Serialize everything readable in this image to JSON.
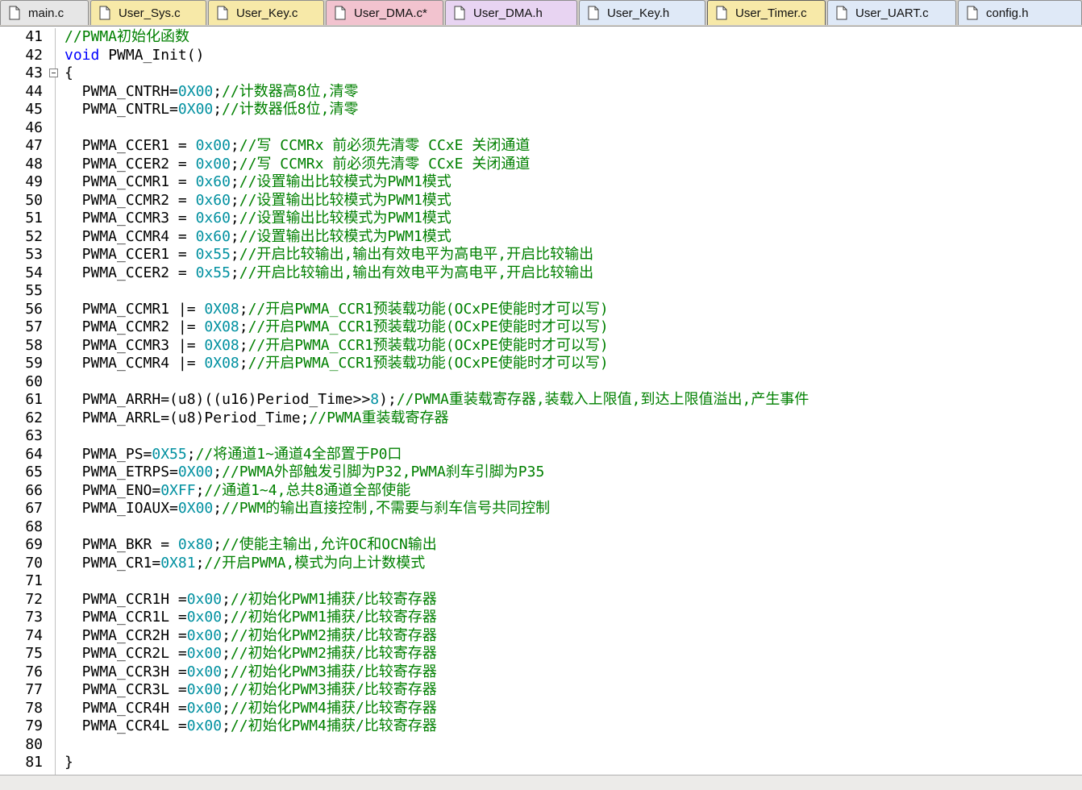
{
  "tabs": [
    {
      "label": "main.c",
      "bg": "#e6e6e6",
      "active": false
    },
    {
      "label": "User_Sys.c",
      "bg": "#f7e9a8",
      "active": false
    },
    {
      "label": "User_Key.c",
      "bg": "#f7e9a8",
      "active": false
    },
    {
      "label": "User_DMA.c*",
      "bg": "#f2c3cf",
      "active": false
    },
    {
      "label": "User_DMA.h",
      "bg": "#e8d4f2",
      "active": false
    },
    {
      "label": "User_Key.h",
      "bg": "#dfe9f7",
      "active": false
    },
    {
      "label": "User_Timer.c",
      "bg": "#f7e9a8",
      "active": true
    },
    {
      "label": "User_UART.c",
      "bg": "#dfe9f7",
      "active": false
    },
    {
      "label": "config.h",
      "bg": "#dfe9f7",
      "active": false
    }
  ],
  "colors": {
    "keyword": "#0000ff",
    "number": "#0090a0",
    "comment": "#008000",
    "text": "#000000"
  },
  "code_lines": [
    {
      "n": "41",
      "tokens": [
        {
          "t": "c",
          "v": "//PWMA初始化函数"
        }
      ]
    },
    {
      "n": "42",
      "tokens": [
        {
          "t": "k",
          "v": "void"
        },
        {
          "t": "x",
          "v": " PWMA_Init()"
        }
      ]
    },
    {
      "n": "43",
      "fold": true,
      "tokens": [
        {
          "t": "x",
          "v": "{"
        }
      ]
    },
    {
      "n": "44",
      "tokens": [
        {
          "t": "x",
          "v": "  PWMA_CNTRH="
        },
        {
          "t": "n",
          "v": "0X00"
        },
        {
          "t": "x",
          "v": ";"
        },
        {
          "t": "c",
          "v": "//计数器高8位,清零"
        }
      ]
    },
    {
      "n": "45",
      "tokens": [
        {
          "t": "x",
          "v": "  PWMA_CNTRL="
        },
        {
          "t": "n",
          "v": "0X00"
        },
        {
          "t": "x",
          "v": ";"
        },
        {
          "t": "c",
          "v": "//计数器低8位,清零"
        }
      ]
    },
    {
      "n": "46",
      "tokens": []
    },
    {
      "n": "47",
      "tokens": [
        {
          "t": "x",
          "v": "  PWMA_CCER1 = "
        },
        {
          "t": "n",
          "v": "0x00"
        },
        {
          "t": "x",
          "v": ";"
        },
        {
          "t": "c",
          "v": "//写 CCMRx 前必须先清零 CCxE 关闭通道"
        }
      ]
    },
    {
      "n": "48",
      "tokens": [
        {
          "t": "x",
          "v": "  PWMA_CCER2 = "
        },
        {
          "t": "n",
          "v": "0x00"
        },
        {
          "t": "x",
          "v": ";"
        },
        {
          "t": "c",
          "v": "//写 CCMRx 前必须先清零 CCxE 关闭通道"
        }
      ]
    },
    {
      "n": "49",
      "tokens": [
        {
          "t": "x",
          "v": "  PWMA_CCMR1 = "
        },
        {
          "t": "n",
          "v": "0x60"
        },
        {
          "t": "x",
          "v": ";"
        },
        {
          "t": "c",
          "v": "//设置输出比较模式为PWM1模式"
        }
      ]
    },
    {
      "n": "50",
      "tokens": [
        {
          "t": "x",
          "v": "  PWMA_CCMR2 = "
        },
        {
          "t": "n",
          "v": "0x60"
        },
        {
          "t": "x",
          "v": ";"
        },
        {
          "t": "c",
          "v": "//设置输出比较模式为PWM1模式"
        }
      ]
    },
    {
      "n": "51",
      "tokens": [
        {
          "t": "x",
          "v": "  PWMA_CCMR3 = "
        },
        {
          "t": "n",
          "v": "0x60"
        },
        {
          "t": "x",
          "v": ";"
        },
        {
          "t": "c",
          "v": "//设置输出比较模式为PWM1模式"
        }
      ]
    },
    {
      "n": "52",
      "tokens": [
        {
          "t": "x",
          "v": "  PWMA_CCMR4 = "
        },
        {
          "t": "n",
          "v": "0x60"
        },
        {
          "t": "x",
          "v": ";"
        },
        {
          "t": "c",
          "v": "//设置输出比较模式为PWM1模式"
        }
      ]
    },
    {
      "n": "53",
      "tokens": [
        {
          "t": "x",
          "v": "  PWMA_CCER1 = "
        },
        {
          "t": "n",
          "v": "0x55"
        },
        {
          "t": "x",
          "v": ";"
        },
        {
          "t": "c",
          "v": "//开启比较输出,输出有效电平为高电平,开启比较输出"
        }
      ]
    },
    {
      "n": "54",
      "tokens": [
        {
          "t": "x",
          "v": "  PWMA_CCER2 = "
        },
        {
          "t": "n",
          "v": "0x55"
        },
        {
          "t": "x",
          "v": ";"
        },
        {
          "t": "c",
          "v": "//开启比较输出,输出有效电平为高电平,开启比较输出"
        }
      ]
    },
    {
      "n": "55",
      "tokens": []
    },
    {
      "n": "56",
      "tokens": [
        {
          "t": "x",
          "v": "  PWMA_CCMR1 |= "
        },
        {
          "t": "n",
          "v": "0X08"
        },
        {
          "t": "x",
          "v": ";"
        },
        {
          "t": "c",
          "v": "//开启PWMA_CCR1预装载功能(OCxPE使能时才可以写)"
        }
      ]
    },
    {
      "n": "57",
      "tokens": [
        {
          "t": "x",
          "v": "  PWMA_CCMR2 |= "
        },
        {
          "t": "n",
          "v": "0X08"
        },
        {
          "t": "x",
          "v": ";"
        },
        {
          "t": "c",
          "v": "//开启PWMA_CCR1预装载功能(OCxPE使能时才可以写)"
        }
      ]
    },
    {
      "n": "58",
      "tokens": [
        {
          "t": "x",
          "v": "  PWMA_CCMR3 |= "
        },
        {
          "t": "n",
          "v": "0X08"
        },
        {
          "t": "x",
          "v": ";"
        },
        {
          "t": "c",
          "v": "//开启PWMA_CCR1预装载功能(OCxPE使能时才可以写)"
        }
      ]
    },
    {
      "n": "59",
      "tokens": [
        {
          "t": "x",
          "v": "  PWMA_CCMR4 |= "
        },
        {
          "t": "n",
          "v": "0X08"
        },
        {
          "t": "x",
          "v": ";"
        },
        {
          "t": "c",
          "v": "//开启PWMA_CCR1预装载功能(OCxPE使能时才可以写)"
        }
      ]
    },
    {
      "n": "60",
      "tokens": []
    },
    {
      "n": "61",
      "tokens": [
        {
          "t": "x",
          "v": "  PWMA_ARRH=(u8)((u16)Period_Time>>"
        },
        {
          "t": "n",
          "v": "8"
        },
        {
          "t": "x",
          "v": ");"
        },
        {
          "t": "c",
          "v": "//PWMA重装载寄存器,装载入上限值,到达上限值溢出,产生事件"
        }
      ]
    },
    {
      "n": "62",
      "tokens": [
        {
          "t": "x",
          "v": "  PWMA_ARRL=(u8)Period_Time;"
        },
        {
          "t": "c",
          "v": "//PWMA重装载寄存器"
        }
      ]
    },
    {
      "n": "63",
      "tokens": []
    },
    {
      "n": "64",
      "tokens": [
        {
          "t": "x",
          "v": "  PWMA_PS="
        },
        {
          "t": "n",
          "v": "0X55"
        },
        {
          "t": "x",
          "v": ";"
        },
        {
          "t": "c",
          "v": "//将通道1~通道4全部置于P0口"
        }
      ]
    },
    {
      "n": "65",
      "tokens": [
        {
          "t": "x",
          "v": "  PWMA_ETRPS="
        },
        {
          "t": "n",
          "v": "0X00"
        },
        {
          "t": "x",
          "v": ";"
        },
        {
          "t": "c",
          "v": "//PWMA外部触发引脚为P32,PWMA刹车引脚为P35"
        }
      ]
    },
    {
      "n": "66",
      "tokens": [
        {
          "t": "x",
          "v": "  PWMA_ENO="
        },
        {
          "t": "n",
          "v": "0XFF"
        },
        {
          "t": "x",
          "v": ";"
        },
        {
          "t": "c",
          "v": "//通道1~4,总共8通道全部使能"
        }
      ]
    },
    {
      "n": "67",
      "tokens": [
        {
          "t": "x",
          "v": "  PWMA_IOAUX="
        },
        {
          "t": "n",
          "v": "0X00"
        },
        {
          "t": "x",
          "v": ";"
        },
        {
          "t": "c",
          "v": "//PWM的输出直接控制,不需要与刹车信号共同控制"
        }
      ]
    },
    {
      "n": "68",
      "tokens": []
    },
    {
      "n": "69",
      "tokens": [
        {
          "t": "x",
          "v": "  PWMA_BKR = "
        },
        {
          "t": "n",
          "v": "0x80"
        },
        {
          "t": "x",
          "v": ";"
        },
        {
          "t": "c",
          "v": "//使能主输出,允许OC和OCN输出"
        }
      ]
    },
    {
      "n": "70",
      "tokens": [
        {
          "t": "x",
          "v": "  PWMA_CR1="
        },
        {
          "t": "n",
          "v": "0X81"
        },
        {
          "t": "x",
          "v": ";"
        },
        {
          "t": "c",
          "v": "//开启PWMA,模式为向上计数模式"
        }
      ]
    },
    {
      "n": "71",
      "tokens": []
    },
    {
      "n": "72",
      "tokens": [
        {
          "t": "x",
          "v": "  PWMA_CCR1H ="
        },
        {
          "t": "n",
          "v": "0x00"
        },
        {
          "t": "x",
          "v": ";"
        },
        {
          "t": "c",
          "v": "//初始化PWM1捕获/比较寄存器"
        }
      ]
    },
    {
      "n": "73",
      "tokens": [
        {
          "t": "x",
          "v": "  PWMA_CCR1L ="
        },
        {
          "t": "n",
          "v": "0x00"
        },
        {
          "t": "x",
          "v": ";"
        },
        {
          "t": "c",
          "v": "//初始化PWM1捕获/比较寄存器"
        }
      ]
    },
    {
      "n": "74",
      "tokens": [
        {
          "t": "x",
          "v": "  PWMA_CCR2H ="
        },
        {
          "t": "n",
          "v": "0x00"
        },
        {
          "t": "x",
          "v": ";"
        },
        {
          "t": "c",
          "v": "//初始化PWM2捕获/比较寄存器"
        }
      ]
    },
    {
      "n": "75",
      "tokens": [
        {
          "t": "x",
          "v": "  PWMA_CCR2L ="
        },
        {
          "t": "n",
          "v": "0x00"
        },
        {
          "t": "x",
          "v": ";"
        },
        {
          "t": "c",
          "v": "//初始化PWM2捕获/比较寄存器"
        }
      ]
    },
    {
      "n": "76",
      "tokens": [
        {
          "t": "x",
          "v": "  PWMA_CCR3H ="
        },
        {
          "t": "n",
          "v": "0x00"
        },
        {
          "t": "x",
          "v": ";"
        },
        {
          "t": "c",
          "v": "//初始化PWM3捕获/比较寄存器"
        }
      ]
    },
    {
      "n": "77",
      "tokens": [
        {
          "t": "x",
          "v": "  PWMA_CCR3L ="
        },
        {
          "t": "n",
          "v": "0x00"
        },
        {
          "t": "x",
          "v": ";"
        },
        {
          "t": "c",
          "v": "//初始化PWM3捕获/比较寄存器"
        }
      ]
    },
    {
      "n": "78",
      "tokens": [
        {
          "t": "x",
          "v": "  PWMA_CCR4H ="
        },
        {
          "t": "n",
          "v": "0x00"
        },
        {
          "t": "x",
          "v": ";"
        },
        {
          "t": "c",
          "v": "//初始化PWM4捕获/比较寄存器"
        }
      ]
    },
    {
      "n": "79",
      "tokens": [
        {
          "t": "x",
          "v": "  PWMA_CCR4L ="
        },
        {
          "t": "n",
          "v": "0x00"
        },
        {
          "t": "x",
          "v": ";"
        },
        {
          "t": "c",
          "v": "//初始化PWM4捕获/比较寄存器"
        }
      ]
    },
    {
      "n": "80",
      "tokens": []
    },
    {
      "n": "81",
      "tokens": [
        {
          "t": "x",
          "v": "}"
        }
      ]
    }
  ]
}
